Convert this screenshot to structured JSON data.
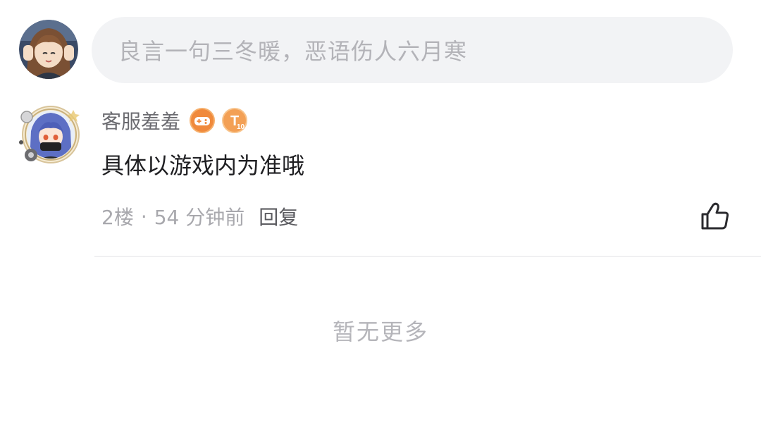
{
  "composer": {
    "placeholder": "良言一句三冬暖，恶语伤人六月寒"
  },
  "comment": {
    "author": "客服羞羞",
    "badges": [
      "game-controller-badge",
      "t10-level-badge"
    ],
    "badge_t10_label": "T10",
    "text": "具体以游戏内为准哦",
    "floor": "2楼",
    "separator": "·",
    "time": "54 分钟前",
    "reply_label": "回复"
  },
  "footer": {
    "no_more": "暂无更多"
  },
  "colors": {
    "input_bg": "#f2f3f5",
    "badge_orange": "#f08a3c",
    "secondary_text": "#a8a8ad"
  }
}
